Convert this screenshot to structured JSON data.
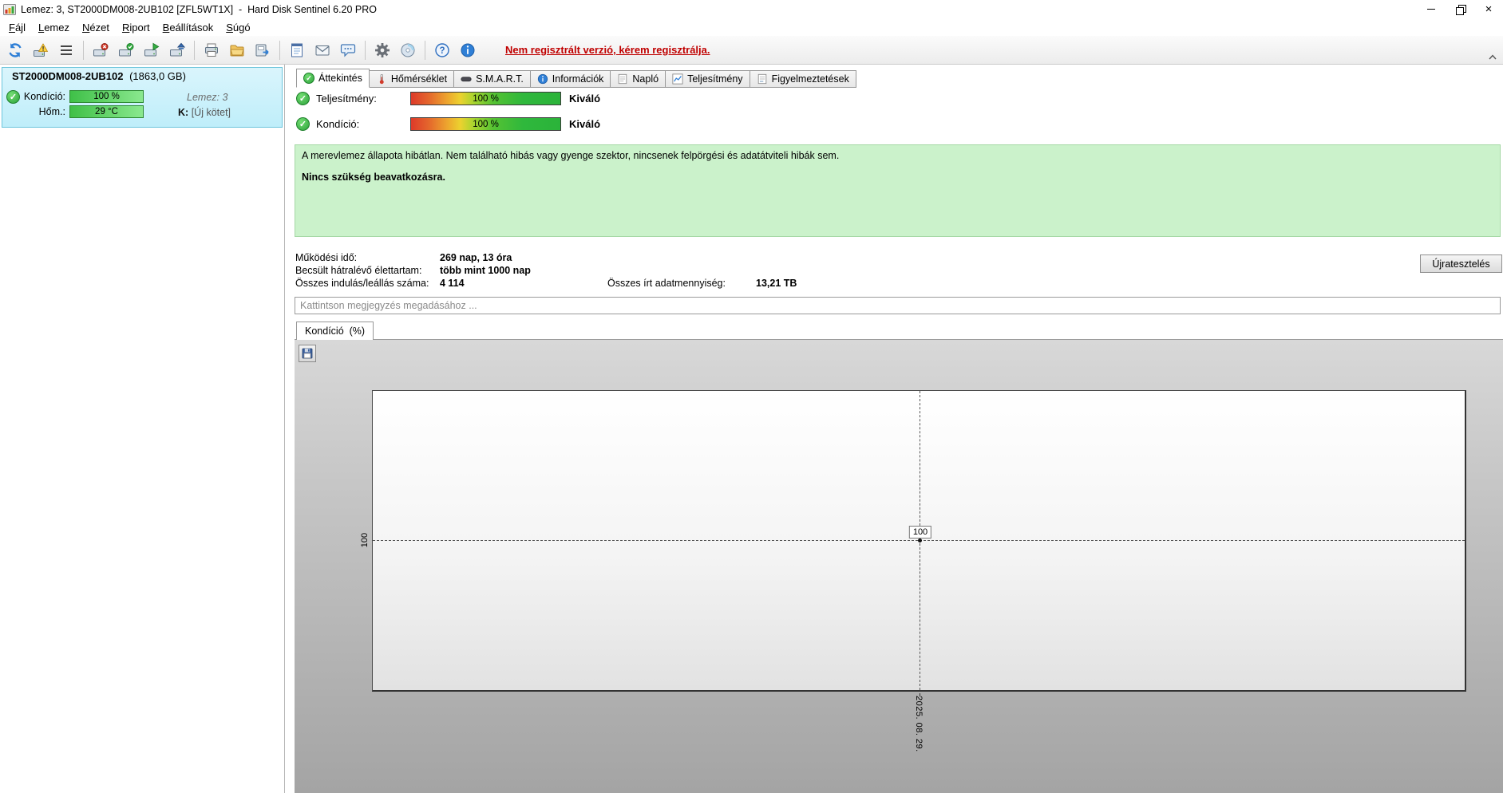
{
  "window": {
    "title": "Lemez: 3, ST2000DM008-2UB102 [ZFL5WT1X]  -  Hard Disk Sentinel 6.20 PRO"
  },
  "icons": {
    "check_icon": "✓",
    "close_icon": "×"
  },
  "menu": {
    "items": [
      {
        "label": "Fájl"
      },
      {
        "label": "Lemez"
      },
      {
        "label": "Nézet"
      },
      {
        "label": "Riport"
      },
      {
        "label": "Beállítások"
      },
      {
        "label": "Súgó"
      }
    ]
  },
  "toolbar": {
    "register_notice": "Nem regisztrált verzió, kérem regisztrálja.",
    "icon_names": [
      "refresh-icon",
      "disk-warning-icon",
      "details-icon",
      "disk-remove-icon",
      "disk-accept-icon",
      "disk-start-icon",
      "disk-eject-icon",
      "print-icon",
      "open-folder-icon",
      "export-icon",
      "report-icon",
      "mail-icon",
      "feedback-icon",
      "settings-gear-icon",
      "cd-icon",
      "help-icon",
      "info-icon",
      "chevron-up-icon"
    ]
  },
  "sidebar": {
    "disk": {
      "model": "ST2000DM008-2UB102",
      "capacity": "(1863,0 GB)",
      "condition_label": "Kondíció:",
      "condition_value": "100 %",
      "disk_number": "Lemez: 3",
      "temperature_label": "Hőm.:",
      "temperature_value": "29 °C",
      "volume_bold": "K:",
      "volume_name": "[Új kötet]"
    }
  },
  "tabs": [
    {
      "label": "Áttekintés"
    },
    {
      "label": "Hőmérséklet"
    },
    {
      "label": "S.M.A.R.T."
    },
    {
      "label": "Információk"
    },
    {
      "label": "Napló"
    },
    {
      "label": "Teljesítmény"
    },
    {
      "label": "Figyelmeztetések"
    }
  ],
  "overview": {
    "metrics": [
      {
        "label": "Teljesítmény:",
        "value": "100 %",
        "rating": "Kiváló"
      },
      {
        "label": "Kondíció:",
        "value": "100 %",
        "rating": "Kiváló"
      }
    ],
    "status_message": "A merevlemez állapota hibátlan. Nem található hibás vagy gyenge szektor, nincsenek felpörgési és adatátviteli hibák sem.",
    "status_action": "Nincs szükség beavatkozásra.",
    "stats": {
      "power_on_label": "Működési idő:",
      "power_on_value": "269 nap, 13 óra",
      "lifetime_label": "Becsült hátralévő élettartam:",
      "lifetime_value": "több mint 1000 nap",
      "start_stop_label": "Összes indulás/leállás száma:",
      "start_stop_value": "4 114",
      "written_label": "Összes írt adatmennyiség:",
      "written_value": "13,21 TB"
    },
    "retest_button": "Újratesztelés",
    "comment_placeholder": "Kattintson megjegyzés megadásához ..."
  },
  "chart": {
    "tab_label": "Kondíció  (%)",
    "y_tick": "100",
    "x_tick": "2025. 08. 29.",
    "point_label": "100",
    "chart_data": {
      "type": "line",
      "title": "Kondíció (%)",
      "x": [
        "2025. 08. 29."
      ],
      "series": [
        {
          "name": "Kondíció (%)",
          "values": [
            100
          ]
        }
      ],
      "y_ticks": [
        100
      ],
      "grid": "dashed crosshair through data point",
      "legend_position": "none"
    }
  }
}
